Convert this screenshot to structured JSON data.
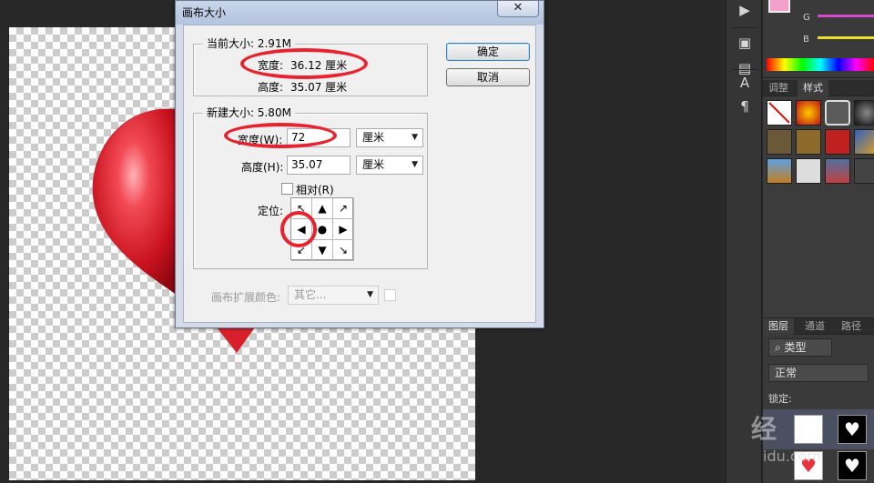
{
  "dialog": {
    "title": "画布大小",
    "close_glyph": "✕",
    "current_group": {
      "legend": "当前大小: 2.91M",
      "width_label": "宽度:",
      "width_value": "36.12 厘米",
      "height_label": "高度:",
      "height_value": "35.07 厘米"
    },
    "new_group": {
      "legend": "新建大小: 5.80M",
      "width_label": "宽度(W):",
      "width_value": "72",
      "width_unit": "厘米",
      "height_label": "高度(H):",
      "height_value": "35.07",
      "height_unit": "厘米",
      "relative_label": "相对(R)",
      "relative_checked": false,
      "anchor_label": "定位:"
    },
    "extension_color_label": "画布扩展颜色:",
    "extension_color_value": "其它...",
    "ok_label": "确定",
    "cancel_label": "取消"
  },
  "anchor_arrows": [
    "↖",
    "▲",
    "↗",
    "◀",
    "●",
    "▶",
    "↙",
    "▼",
    "↘"
  ],
  "right_panel": {
    "channel_g": "G",
    "channel_b": "B",
    "tab_adjust": "调整",
    "tab_styles": "样式",
    "layers_tab": "图层",
    "channels_tab": "通道",
    "paths_tab": "路径",
    "filter_kind": "类型",
    "blend_mode": "正常",
    "lock_label": "锁定:"
  },
  "watermark": {
    "text1": "经",
    "text2": "idu.com"
  },
  "colors": {
    "annotation_red": "#e8232f",
    "heart_red": "#d8202c"
  }
}
